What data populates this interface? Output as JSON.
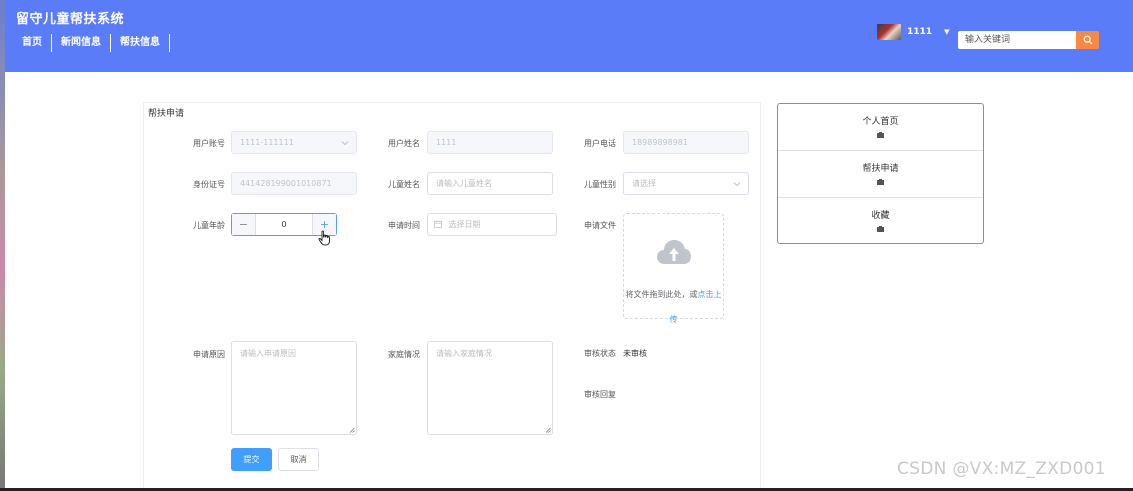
{
  "header": {
    "title": "留守儿童帮扶系统",
    "nav": [
      "首页",
      "新闻信息",
      "帮扶信息"
    ],
    "username": "1111",
    "search_placeholder": "输入关键词",
    "brand_color": "#5b7cf9",
    "search_button_color": "#f68a43"
  },
  "form": {
    "title": "帮扶申请",
    "account_label": "用户账号",
    "account_value": "1111-111111",
    "name_label": "用户姓名",
    "name_value": "1111",
    "phone_label": "用户电话",
    "phone_value": "18989898981",
    "id_label": "身份证号",
    "id_value": "441428199001010871",
    "child_name_label": "儿童姓名",
    "child_name_placeholder": "请输入儿童姓名",
    "child_gender_label": "儿童性别",
    "child_gender_placeholder": "请选择",
    "child_age_label": "儿童年龄",
    "child_age_value": "0",
    "apply_time_label": "申请时间",
    "apply_time_placeholder": "选择日期",
    "apply_file_label": "申请文件",
    "upload_text": "将文件拖到此处，或",
    "upload_link": "点击上传",
    "reason_label": "申请原因",
    "reason_placeholder": "请输入申请原因",
    "family_label": "家庭情况",
    "family_placeholder": "请输入家庭情况",
    "review_status_label": "审核状态",
    "review_status_value": "未审核",
    "review_reply_label": "审核回复",
    "submit_label": "提交",
    "cancel_label": "取消"
  },
  "side_menu": {
    "items": [
      {
        "label": "个人首页"
      },
      {
        "label": "帮扶申请"
      },
      {
        "label": "收藏"
      }
    ]
  },
  "watermark": "CSDN @VX:MZ_ZXD001"
}
